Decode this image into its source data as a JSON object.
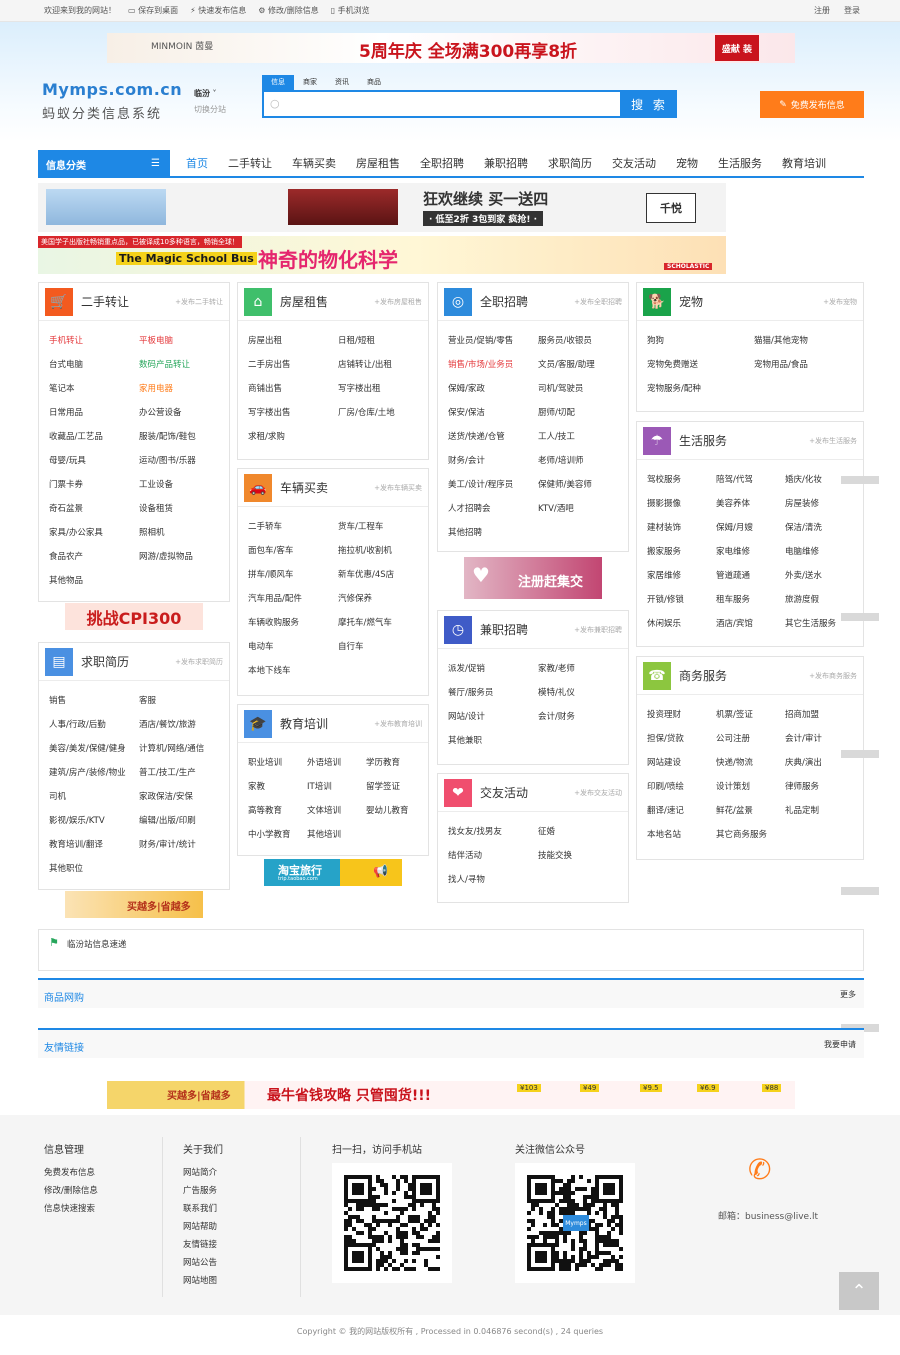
{
  "topbar": {
    "welcome": "欢迎来到我的网站！",
    "save_desktop": "保存到桌面",
    "quick_post": "快速发布信息",
    "edit_delete": "修改/删除信息",
    "mobile": "手机浏览",
    "register": "注册",
    "login": "登录"
  },
  "banner_ad": {
    "brand": "MINMOIN 茵曼",
    "slogan": "5周年庆 全场满300再享8折",
    "badge": "盛献 装"
  },
  "logo": {
    "domain": "Mymps.com.cn",
    "name": "蚂蚁分类信息系统"
  },
  "city": {
    "name": "临汾",
    "switch": "切换分站"
  },
  "search": {
    "tabs": [
      "信息",
      "商家",
      "资讯",
      "商品"
    ],
    "placeholder": "",
    "button": "搜 索"
  },
  "publish_button": "免费发布信息",
  "nav": {
    "category_label": "信息分类",
    "links": [
      "首页",
      "二手转让",
      "车辆买卖",
      "房屋租售",
      "全职招聘",
      "兼职招聘",
      "求职简历",
      "交友活动",
      "宠物",
      "生活服务",
      "教育培训"
    ]
  },
  "ads": {
    "furniture": "狂欢继续 买一送四",
    "furniture_sub": "· 低至2折 3包到家 疯抢! ·",
    "furniture_brand": "千悦",
    "magic_top": "美国学子出版社畅销重点品，已被译成10多种语言，畅销全球！",
    "magic_title": "The Magic School Bus",
    "magic_cn": "神奇的物化科学",
    "magic_brand": "SCHOLASTIC",
    "cpi": "挑战CPI300",
    "register": "注册赶集交",
    "taobao": "淘宝旅行",
    "taobao_url": "trip.taobao.com",
    "buymore": "买越多|省越多",
    "bottom_slogan": "最牛省钱攻略 只管囤货!!!",
    "bottom_prices": [
      "¥103",
      "¥49",
      "¥9.5",
      "¥6.9",
      "¥88"
    ]
  },
  "panels": {
    "ershou": {
      "title": "二手转让",
      "pub": "+发布二手转让",
      "items": [
        "手机转让",
        "平板电脑",
        "台式电脑",
        "数码产品转让",
        "笔记本",
        "家用电器",
        "日常用品",
        "办公营设备",
        "收藏品/工艺品",
        "服装/配饰/鞋包",
        "母婴/玩具",
        "运动/图书/乐器",
        "门票卡券",
        "工业设备",
        "奇石盆景",
        "设备租赁",
        "家具/办公家具",
        "照相机",
        "食品农产",
        "网游/虚拟物品",
        "其他物品"
      ]
    },
    "fangwu": {
      "title": "房屋租售",
      "pub": "+发布房屋租售",
      "items": [
        "房屋出租",
        "日租/短租",
        "二手房出售",
        "店铺转让/出租",
        "商铺出售",
        "写字楼出租",
        "写字楼出售",
        "厂房/仓库/土地",
        "求租/求购"
      ]
    },
    "quanzhi": {
      "title": "全职招聘",
      "pub": "+发布全职招聘",
      "items": [
        "营业员/促销/零售",
        "服务员/收银员",
        "销售/市场/业务员",
        "文员/客服/助理",
        "保姆/家政",
        "司机/驾驶员",
        "保安/保洁",
        "厨师/切配",
        "送货/快递/仓管",
        "工人/技工",
        "财务/会计",
        "老师/培训师",
        "美工/设计/程序员",
        "保健师/美容师",
        "人才招聘会",
        "KTV/酒吧",
        "其他招聘"
      ]
    },
    "chongwu": {
      "title": "宠物",
      "pub": "+发布宠物",
      "items": [
        "狗狗",
        "猫猫/其他宠物",
        "宠物免费赠送",
        "宠物用品/食品",
        "宠物服务/配种"
      ]
    },
    "shenghuo": {
      "title": "生活服务",
      "pub": "+发布生活服务",
      "items": [
        "驾校服务",
        "陪驾/代驾",
        "婚庆/化妆",
        "摄影摄像",
        "美容养体",
        "房屋装修",
        "建材装饰",
        "保姆/月嫂",
        "保洁/清洗",
        "搬家服务",
        "家电维修",
        "电脑维修",
        "家居维修",
        "管道疏通",
        "外卖/送水",
        "开锁/修锁",
        "租车服务",
        "旅游度假",
        "休闲娱乐",
        "酒店/宾馆",
        "其它生活服务"
      ]
    },
    "cheliang": {
      "title": "车辆买卖",
      "pub": "+发布车辆买卖",
      "items": [
        "二手轿车",
        "货车/工程车",
        "面包车/客车",
        "拖拉机/收割机",
        "拼车/顺风车",
        "新车优惠/4S店",
        "汽车用品/配件",
        "汽修保养",
        "车辆收购服务",
        "摩托车/燃气车",
        "电动车",
        "自行车",
        "本地下线车"
      ]
    },
    "qiuzhi": {
      "title": "求职简历",
      "pub": "+发布求职简历",
      "items": [
        "销售",
        "客服",
        "人事/行政/后勤",
        "酒店/餐饮/旅游",
        "美容/美发/保健/健身",
        "计算机/网络/通信",
        "建筑/房产/装修/物业",
        "普工/技工/生产",
        "司机",
        "家政保洁/安保",
        "影视/娱乐/KTV",
        "编辑/出版/印刷",
        "教育培训/翻译",
        "财务/审计/统计",
        "其他职位"
      ]
    },
    "jianzhi": {
      "title": "兼职招聘",
      "pub": "+发布兼职招聘",
      "items": [
        "派发/促销",
        "家教/老师",
        "餐厅/服务员",
        "模特/礼仪",
        "网站/设计",
        "会计/财务",
        "其他兼职"
      ]
    },
    "jiaoyu": {
      "title": "教育培训",
      "pub": "+发布教育培训",
      "items": [
        "职业培训",
        "外语培训",
        "学历教育",
        "家教",
        "IT培训",
        "留学签证",
        "高等教育",
        "文体培训",
        "婴幼儿教育",
        "中小学教育",
        "其他培训"
      ]
    },
    "jiaoyou": {
      "title": "交友活动",
      "pub": "+发布交友活动",
      "items": [
        "找女友/找男友",
        "征婚",
        "结伴活动",
        "技能交换",
        "找人/寻物"
      ]
    },
    "shangwu": {
      "title": "商务服务",
      "pub": "+发布商务服务",
      "items": [
        "投资理财",
        "机票/签证",
        "招商加盟",
        "担保/贷款",
        "公司注册",
        "会计/审计",
        "网站建设",
        "快递/物流",
        "庆典/演出",
        "印刷/喷绘",
        "设计策划",
        "律师服务",
        "翻译/速记",
        "鲜花/盆景",
        "礼品定制",
        "本地名站",
        "其它商务服务"
      ]
    }
  },
  "speed": {
    "title": "临汾站信息速递"
  },
  "goods": {
    "title": "商品网购",
    "more": "更多"
  },
  "links": {
    "title": "友情链接",
    "apply": "我要申请"
  },
  "footer": {
    "col1": {
      "title": "信息管理",
      "items": [
        "免费发布信息",
        "修改/删除信息",
        "信息快速搜索"
      ]
    },
    "col2": {
      "title": "关于我们",
      "items": [
        "网站简介",
        "广告服务",
        "联系我们",
        "网站帮助",
        "友情链接",
        "网站公告",
        "网站地图"
      ]
    },
    "qr1": "扫一扫，访问手机站",
    "qr2": "关注微信公众号",
    "qr_logo": "Mymps",
    "email": "邮箱：business@live.lt"
  },
  "copyright": "Copyright © 我的网站版权所有 , Processed in 0.046876 second(s) , 24 queries"
}
